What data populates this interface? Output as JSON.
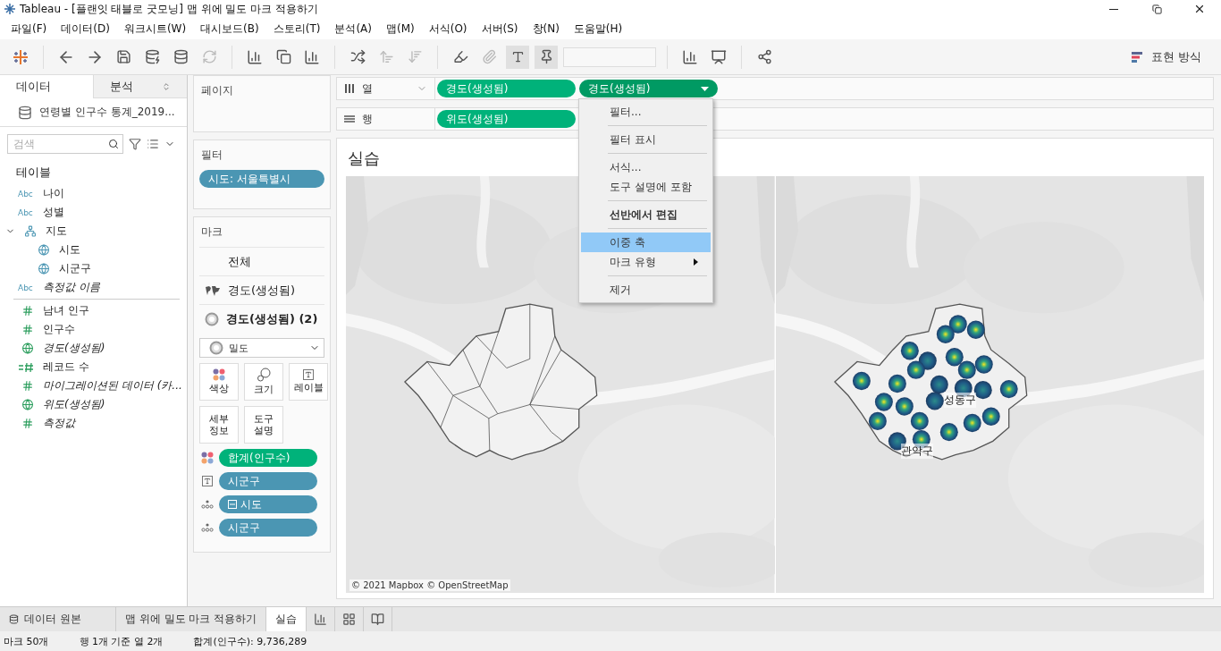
{
  "window": {
    "title": "Tableau - [플랜잇 태블로 굿모닝] 맵 위에 밀도 마크 적용하기"
  },
  "menu": [
    "파일(F)",
    "데이터(D)",
    "워크시트(W)",
    "대시보드(B)",
    "스토리(T)",
    "분석(A)",
    "맵(M)",
    "서식(O)",
    "서버(S)",
    "창(N)",
    "도움말(H)"
  ],
  "toolbar": {
    "show_me": "표현 방식"
  },
  "data_pane": {
    "tabs": [
      {
        "label": "데이터",
        "selected": true
      },
      {
        "label": "분석",
        "selected": false
      }
    ],
    "source": "연령별 인구수 통계_2019...",
    "search": {
      "placeholder": "검색"
    },
    "section": "테이블",
    "fields": [
      {
        "badge": "Abc",
        "name": "나이",
        "kind": "abc",
        "measure": false,
        "italic": false
      },
      {
        "badge": "Abc",
        "name": "성별",
        "kind": "abc",
        "measure": false,
        "italic": false
      },
      {
        "name": "지도",
        "kind": "hierarchy",
        "measure": false,
        "italic": false,
        "expanded": true,
        "children": [
          {
            "name": "시도",
            "kind": "geo",
            "measure": false,
            "italic": false
          },
          {
            "name": "시군구",
            "kind": "geo",
            "measure": false,
            "italic": false
          }
        ]
      },
      {
        "badge": "Abc",
        "name": "측정값 이름",
        "kind": "abc",
        "measure": false,
        "italic": true
      },
      {
        "name": "남녀 인구",
        "kind": "number",
        "measure": true,
        "italic": false
      },
      {
        "name": "인구수",
        "kind": "number",
        "measure": true,
        "italic": false
      },
      {
        "name": "경도(생성됨)",
        "kind": "geo",
        "measure": true,
        "italic": true
      },
      {
        "name": "레코드 수",
        "kind": "count",
        "measure": true,
        "italic": false
      },
      {
        "name": "마이그레이션된 데이터 (카...",
        "kind": "number",
        "measure": true,
        "italic": true
      },
      {
        "name": "위도(생성됨)",
        "kind": "geo",
        "measure": true,
        "italic": true
      },
      {
        "name": "측정값",
        "kind": "number",
        "measure": true,
        "italic": true
      }
    ]
  },
  "pages": {
    "title": "페이지"
  },
  "filters": {
    "title": "필터",
    "pills": [
      {
        "label": "시도: 서울특별시",
        "measure": false
      }
    ]
  },
  "marks": {
    "title": "마크",
    "layers": [
      {
        "label": "전체",
        "kind": "all",
        "selected": false
      },
      {
        "label": "경도(생성됨)",
        "kind": "map",
        "selected": false
      },
      {
        "label": "경도(생성됨) (2)",
        "kind": "density",
        "selected": true
      }
    ],
    "mark_type": "밀도",
    "buttons": [
      {
        "label": "색상",
        "kind": "color"
      },
      {
        "label": "크기",
        "kind": "size"
      },
      {
        "label": "레이블",
        "kind": "label"
      },
      {
        "label": "세부\n정보",
        "kind": "detail"
      },
      {
        "label": "도구\n설명",
        "kind": "tooltip"
      }
    ],
    "pills": [
      {
        "kind": "color",
        "label": "합계(인구수)",
        "measure": true,
        "hierarchy": false
      },
      {
        "kind": "label",
        "label": "시군구",
        "measure": false,
        "hierarchy": false
      },
      {
        "kind": "detail",
        "label": "시도",
        "measure": false,
        "hierarchy": true
      },
      {
        "kind": "detail",
        "label": "시군구",
        "measure": false,
        "hierarchy": false
      }
    ]
  },
  "columns": {
    "label": "열",
    "pills": [
      {
        "label": "경도(생성됨)",
        "measure": true,
        "menu_open": false
      },
      {
        "label": "경도(생성됨)",
        "measure": true,
        "menu_open": true
      }
    ]
  },
  "rows": {
    "label": "행",
    "pills": [
      {
        "label": "위도(생성됨)",
        "measure": true,
        "menu_open": false
      }
    ]
  },
  "context_menu": {
    "groups": [
      [
        {
          "label": "필터...",
          "kind": "plain",
          "selected": false
        }
      ],
      [
        {
          "label": "필터 표시",
          "kind": "plain",
          "selected": false
        }
      ],
      [
        {
          "label": "서식...",
          "kind": "plain",
          "selected": false
        },
        {
          "label": "도구 설명에 포함",
          "kind": "plain",
          "selected": false
        }
      ],
      [
        {
          "label": "선반에서 편집",
          "kind": "default",
          "selected": false
        }
      ],
      [
        {
          "label": "이중 축",
          "kind": "plain",
          "selected": true
        },
        {
          "label": "마크 유형",
          "kind": "submenu",
          "selected": false
        }
      ],
      [
        {
          "label": "제거",
          "kind": "plain",
          "selected": false
        }
      ]
    ]
  },
  "view": {
    "title": "실습",
    "maps": [
      {
        "kind": "boundaries"
      },
      {
        "kind": "density",
        "labels": [
          {
            "text": "성동구",
            "kind": "east"
          },
          {
            "text": "관악구",
            "kind": "south"
          }
        ]
      }
    ],
    "credit": "© 2021 Mapbox © OpenStreetMap"
  },
  "sheet_tabs": [
    {
      "label": "데이터 원본",
      "kind": "datasource",
      "selected": false
    },
    {
      "label": "맵 위에 밀도 마크 적용하기",
      "kind": "sheet",
      "selected": false
    },
    {
      "label": "실습",
      "kind": "sheet",
      "selected": true
    }
  ],
  "status": [
    "마크 50개",
    "행 1개 기준 열 2개",
    "합계(인구수): 9,736,289"
  ]
}
